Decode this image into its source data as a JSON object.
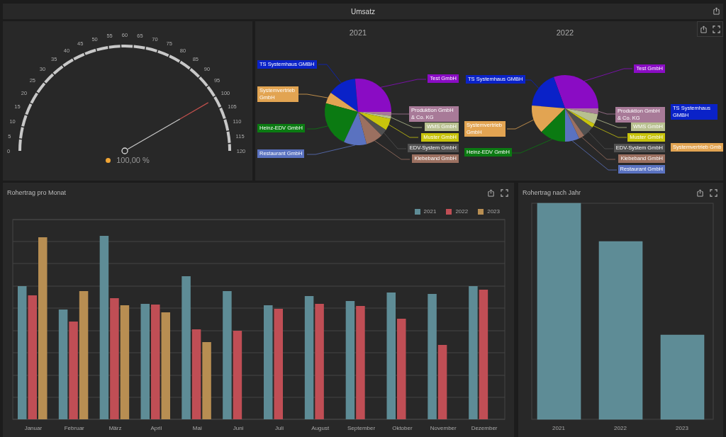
{
  "header": {
    "title": "Umsatz"
  },
  "gauge": {
    "ticks": [
      "0",
      "5",
      "10",
      "15",
      "20",
      "25",
      "30",
      "35",
      "40",
      "45",
      "50",
      "55",
      "60",
      "65",
      "70",
      "75",
      "80",
      "85",
      "90",
      "95",
      "100",
      "105",
      "110",
      "115",
      "120"
    ],
    "level": 0.833,
    "reading": "100,00 %"
  },
  "pies": [
    {
      "title": "2021",
      "labels": [
        {
          "text": "TS Systemhaus GMBH",
          "color": "#0a22c8"
        },
        {
          "text": "Test GmbH",
          "color": "#8a0cc4"
        },
        {
          "text": "Systemvertrieb GmbH",
          "color": "#e2a452"
        },
        {
          "text": "Produktion GmbH & Co. KG",
          "color": "#a87a98"
        },
        {
          "text": "WMS GmbH",
          "color": "#b8c090"
        },
        {
          "text": "Heinz-EDV GmbH",
          "color": "#0b7a12"
        },
        {
          "text": "Muster GmbH",
          "color": "#c8c40c"
        },
        {
          "text": "EDV-System GmbH",
          "color": "#505050"
        },
        {
          "text": "Restaurant GmbH",
          "color": "#5a72c0"
        },
        {
          "text": "Klebeband GmbH",
          "color": "#9b7060"
        }
      ]
    },
    {
      "title": "2022",
      "labels": [
        {
          "text": "Test GmbH",
          "color": "#8a0cc4"
        },
        {
          "text": "TS Systemhaus GMBH",
          "color": "#0a22c8"
        },
        {
          "text": "Produktion GmbH & Co. KG",
          "color": "#a87a98"
        },
        {
          "text": "TS Systemhaus GMBH",
          "color": "#0a22c8"
        },
        {
          "text": "Systemvertrieb GmbH",
          "color": "#e2a452"
        },
        {
          "text": "WMS GmbH",
          "color": "#b8c090"
        },
        {
          "text": "Muster GmbH",
          "color": "#c8c40c"
        },
        {
          "text": "EDV-System GmbH",
          "color": "#505050"
        },
        {
          "text": "Systemvertrieb Gmb",
          "color": "#e2a452"
        },
        {
          "text": "Heinz-EDV GmbH",
          "color": "#0b7a12"
        },
        {
          "text": "Klebeband GmbH",
          "color": "#9b7060"
        },
        {
          "text": "Restaurant GmbH",
          "color": "#5a72c0"
        }
      ]
    }
  ],
  "monthly": {
    "title": "Rohertrag pro Monat",
    "legend": [
      {
        "name": "2021",
        "color": "#5e8c96"
      },
      {
        "name": "2022",
        "color": "#c04e55"
      },
      {
        "name": "2023",
        "color": "#b88e52"
      }
    ],
    "categories": [
      "Januar",
      "Februar",
      "März",
      "April",
      "Mai",
      "Juni",
      "Juli",
      "August",
      "September",
      "Oktober",
      "November",
      "Dezember"
    ]
  },
  "yearly": {
    "title": "Rohertrag nach Jahr",
    "categories": [
      "2021",
      "2022",
      "2023"
    ]
  }
}
